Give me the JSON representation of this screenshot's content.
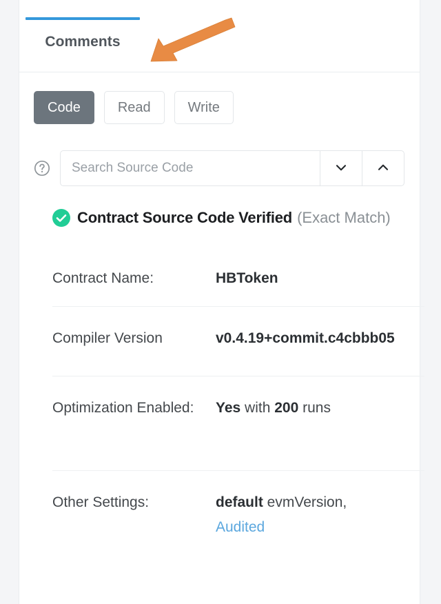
{
  "tabs": [
    {
      "label": "Comments",
      "active": true
    }
  ],
  "annotation": {
    "type": "arrow",
    "color": "#e88b44",
    "points_to": "Comments tab"
  },
  "view_buttons": [
    {
      "label": "Code",
      "active": true
    },
    {
      "label": "Read",
      "active": false
    },
    {
      "label": "Write",
      "active": false
    }
  ],
  "search": {
    "help_icon": "question-circle-icon",
    "placeholder": "Search Source Code",
    "value": "",
    "next_icon": "chevron-down-icon",
    "prev_icon": "chevron-up-icon"
  },
  "verification": {
    "icon": "check-circle-icon",
    "icon_color": "#21cd96",
    "title": "Contract Source Code Verified",
    "subtitle": "(Exact Match)"
  },
  "details": [
    {
      "label": "Contract Name:",
      "value_bold": "HBToken",
      "value_rest": ""
    },
    {
      "label": "Compiler Version",
      "value_bold": "v0.4.19+commit.c4cbbb05",
      "value_rest": ""
    },
    {
      "label": "Optimization Enabled:",
      "value_bold": "Yes",
      "value_mid": " with ",
      "value_bold2": "200",
      "value_rest": " runs"
    },
    {
      "label": "Other Settings:",
      "value_bold": "default",
      "value_rest": " evmVersion,",
      "link": "Audited"
    }
  ],
  "colors": {
    "tab_accent": "#3498db",
    "active_button": "#6c757d",
    "verified_green": "#21cd96",
    "link_blue": "#5ba7de",
    "arrow_orange": "#e88b44",
    "page_background": "#f4f5f7",
    "card_background": "#ffffff"
  }
}
